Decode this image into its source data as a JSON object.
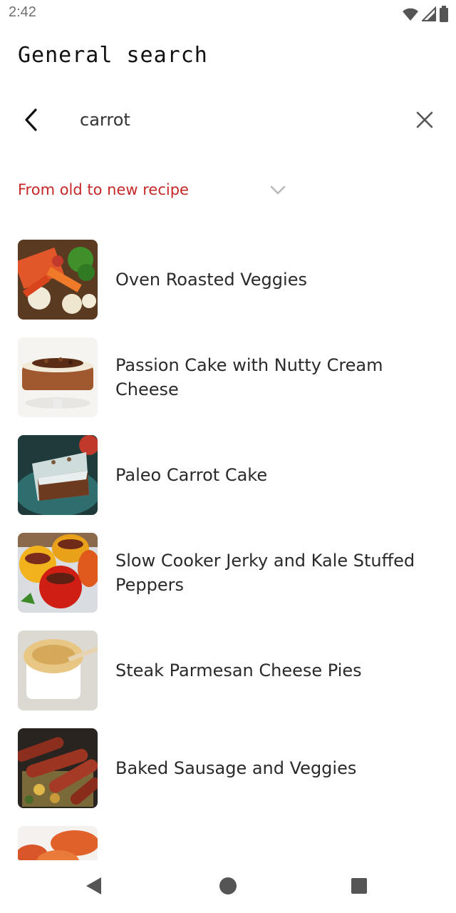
{
  "status_bar": {
    "time": "2:42",
    "icons": [
      "wifi-icon",
      "cell-signal-icon",
      "battery-icon"
    ]
  },
  "header": {
    "title": "General search"
  },
  "search": {
    "value": "carrot",
    "back_icon": "chevron-left-icon",
    "clear_icon": "close-icon"
  },
  "sort": {
    "selected": "From old to new recipe",
    "icon": "chevron-down-icon",
    "color": "#c62828"
  },
  "recipes": [
    {
      "name": "Oven Roasted Veggies"
    },
    {
      "name": "Passion Cake with Nutty Cream Cheese"
    },
    {
      "name": "Paleo Carrot Cake"
    },
    {
      "name": "Slow Cooker Jerky and Kale Stuffed Peppers"
    },
    {
      "name": "Steak Parmesan Cheese Pies"
    },
    {
      "name": "Baked Sausage and Veggies"
    },
    {
      "name": ""
    }
  ],
  "nav_bar": {
    "icons": [
      "back-triangle-icon",
      "home-circle-icon",
      "recents-square-icon"
    ]
  }
}
